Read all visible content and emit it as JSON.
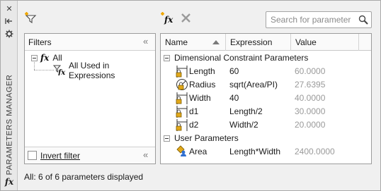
{
  "window": {
    "title": "PARAMETERS MANAGER"
  },
  "toolbar": {
    "search_placeholder": "Search for parameter"
  },
  "filters": {
    "header": "Filters",
    "tree": [
      {
        "label": "All",
        "icon": "fx-icon",
        "expanded": true
      },
      {
        "label": "All Used in Expressions",
        "icon": "filter-fx-icon"
      }
    ],
    "invert_label": "Invert filter",
    "invert_checked": false
  },
  "grid": {
    "columns": [
      "Name",
      "Expression",
      "Value"
    ],
    "sort_column": "Name",
    "groups": [
      {
        "title": "Dimensional Constraint Parameters",
        "rows": [
          {
            "name": "Length",
            "expression": "60",
            "value": "60.0000",
            "icon": "linear-dimension-lock-icon"
          },
          {
            "name": "Radius",
            "expression": "sqrt(Area/PI)",
            "value": "27.6395",
            "icon": "radial-dimension-lock-icon"
          },
          {
            "name": "Width",
            "expression": "40",
            "value": "40.0000",
            "icon": "linear-dimension-lock-icon"
          },
          {
            "name": "d1",
            "expression": "Length/2",
            "value": "30.0000",
            "icon": "linear-dimension-lock-icon"
          },
          {
            "name": "d2",
            "expression": "Width/2",
            "value": "20.0000",
            "icon": "linear-dimension-lock-icon"
          }
        ]
      },
      {
        "title": "User Parameters",
        "rows": [
          {
            "name": "Area",
            "expression": "Length*Width",
            "value": "2400.0000",
            "icon": "user-parameter-icon"
          }
        ]
      }
    ]
  },
  "status": "All: 6 of 6 parameters displayed",
  "colors": {
    "lock_gold": "#e2a81a",
    "user_param_blue": "#2f6fd0",
    "delete_gray": "#9a9a9a"
  }
}
